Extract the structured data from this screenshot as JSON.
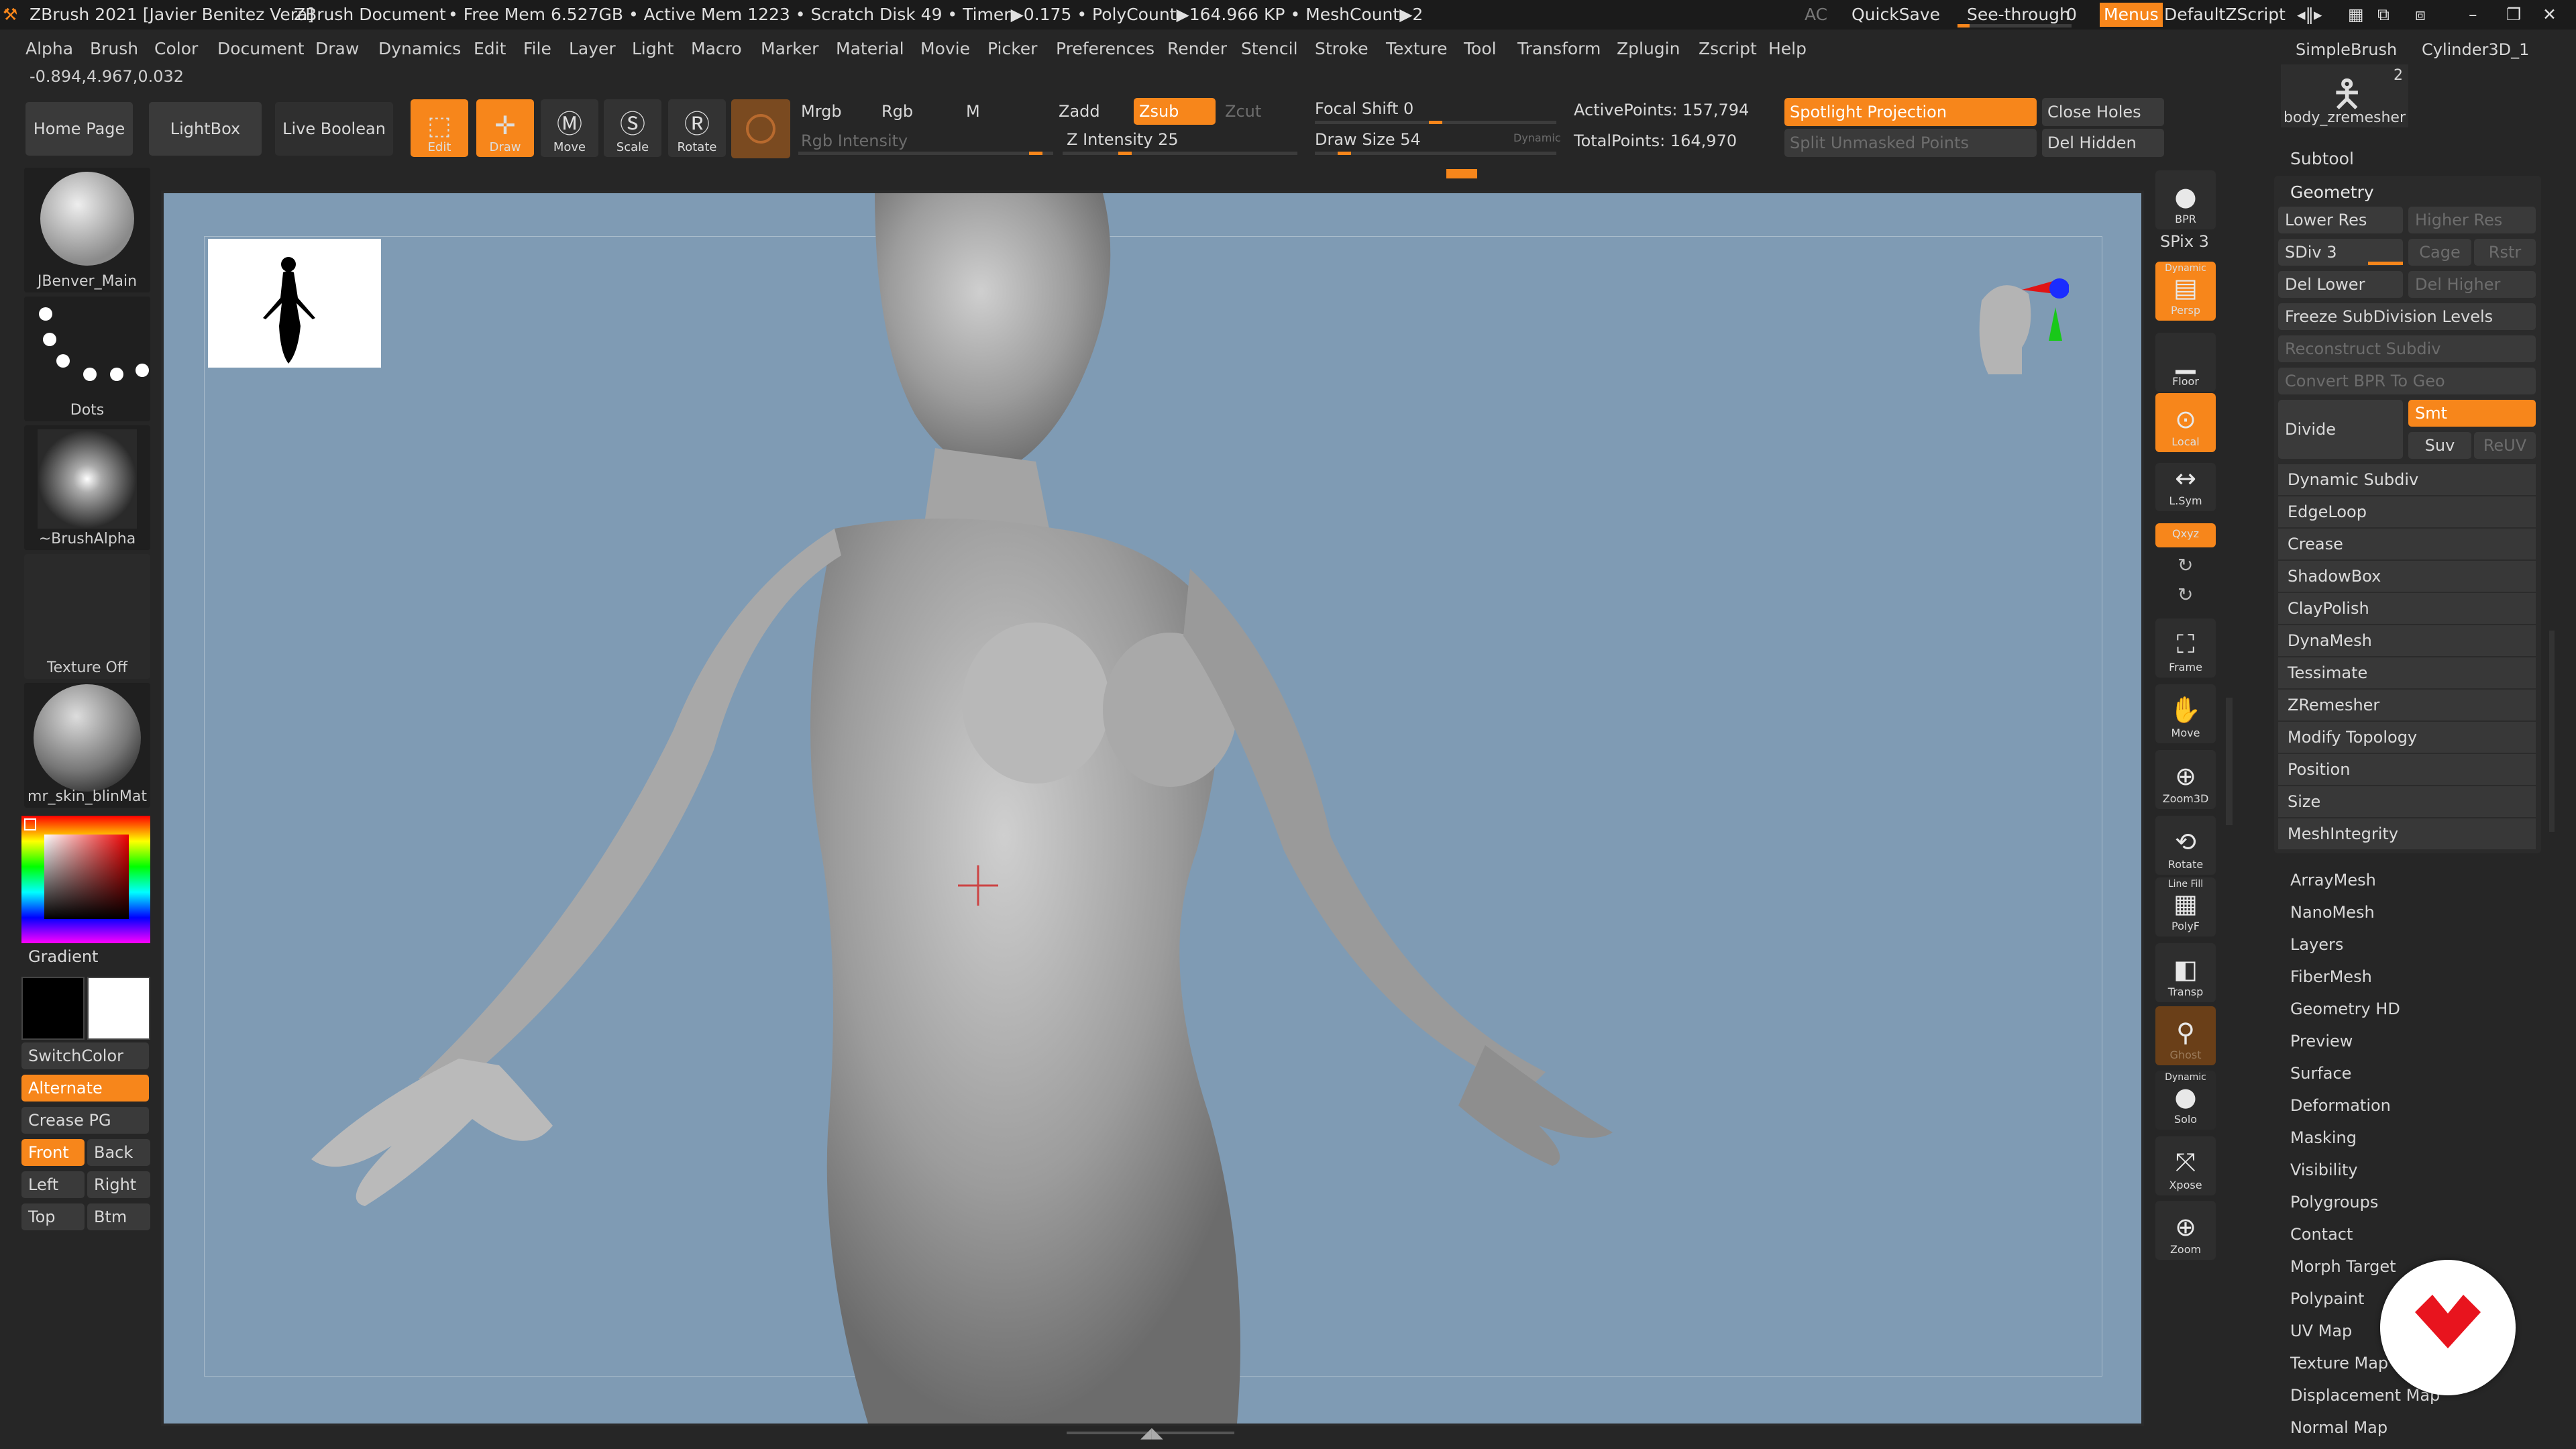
{
  "title_bar": {
    "app_title": "ZBrush 2021 [Javier Benitez Vera]",
    "document": "ZBrush Document",
    "stats": "• Free Mem 6.527GB • Active Mem 1223 • Scratch Disk 49 • Timer▶0.175 • PolyCount▶164.966 KP • MeshCount▶2",
    "ac": "AC",
    "quicksave": "QuickSave",
    "see_through": "See-through",
    "see_through_value": "0",
    "menus": "Menus",
    "script": "DefaultZScript"
  },
  "menu": [
    "Alpha",
    "Brush",
    "Color",
    "Document",
    "Draw",
    "Dynamics",
    "Edit",
    "File",
    "Layer",
    "Light",
    "Macro",
    "Marker",
    "Material",
    "Movie",
    "Picker",
    "Preferences",
    "Render",
    "Stencil",
    "Stroke",
    "Texture",
    "Tool",
    "Transform",
    "Zplugin",
    "Zscript",
    "Help"
  ],
  "coords": "-0.894,4.967,0.032",
  "shelf": {
    "home": "Home Page",
    "lightbox": "LightBox",
    "live_boolean": "Live Boolean"
  },
  "tools": {
    "edit": "Edit",
    "draw": "Draw",
    "move": "Move",
    "scale": "Scale",
    "rotate": "Rotate"
  },
  "color_modes": {
    "mrgb": "Mrgb",
    "rgb": "Rgb",
    "m": "M",
    "rgb_intensity": "Rgb Intensity"
  },
  "z_modes": {
    "zadd": "Zadd",
    "zsub": "Zsub",
    "zcut": "Zcut",
    "z_intensity": "Z Intensity 25",
    "z_intensity_value": 0.25
  },
  "focal": {
    "label": "Focal Shift 0",
    "value": 0.5
  },
  "draw_size": {
    "label": "Draw Size 54",
    "dynamic": "Dynamic",
    "value": 0.1
  },
  "points": {
    "active": "ActivePoints: 157,794",
    "total": "TotalPoints: 164,970"
  },
  "spotlight": {
    "projection": "Spotlight Projection",
    "split": "Split Unmasked Points",
    "close_holes": "Close Holes",
    "del_hidden": "Del Hidden"
  },
  "left": {
    "brush": "JBenver_Main",
    "stroke": "Dots",
    "alpha": "~BrushAlpha",
    "texture": "Texture Off",
    "material": "mr_skin_blinMat",
    "gradient": "Gradient",
    "switch": "SwitchColor",
    "alternate": "Alternate",
    "crease": "Crease PG",
    "front": "Front",
    "back": "Back",
    "left": "Left",
    "right": "Right",
    "top": "Top",
    "btm": "Btm"
  },
  "right_tools": {
    "bpr": "BPR",
    "spix": "SPix 3",
    "persp": "Persp",
    "dynamic": "Dynamic",
    "floor": "Floor",
    "local": "Local",
    "lsym": "L.Sym",
    "xyz": "Qxyz",
    "frame": "Frame",
    "move": "Move",
    "zoom3d": "Zoom3D",
    "rotate": "Rotate",
    "linefill": "Line Fill",
    "polyf": "PolyF",
    "transp": "Transp",
    "ghost": "Ghost",
    "solo": "Solo",
    "xpose": "Xpose",
    "zoom": "Zoom"
  },
  "tool_thumbs": {
    "simplebrush": "SimpleBrush",
    "cylinder": "Cylinder3D_1",
    "count": "2",
    "mesh": "body_zremesher"
  },
  "subtool": "Subtool",
  "geometry": {
    "title": "Geometry",
    "lower_res": "Lower Res",
    "higher_res": "Higher Res",
    "sdiv": "SDiv 3",
    "cage": "Cage",
    "rstr": "Rstr",
    "del_lower": "Del Lower",
    "del_higher": "Del Higher",
    "freeze": "Freeze SubDivision Levels",
    "reconstruct": "Reconstruct Subdiv",
    "convert": "Convert BPR To Geo",
    "divide": "Divide",
    "smt": "Smt",
    "suv": "Suv",
    "reuv": "ReUV",
    "items": [
      "Dynamic Subdiv",
      "EdgeLoop",
      "Crease",
      "ShadowBox",
      "ClayPolish",
      "DynaMesh",
      "Tessimate",
      "ZRemesher",
      "Modify Topology",
      "Position",
      "Size",
      "MeshIntegrity"
    ]
  },
  "subpalettes": [
    "ArrayMesh",
    "NanoMesh",
    "Layers",
    "FiberMesh",
    "Geometry HD",
    "Preview",
    "Surface",
    "Deformation",
    "Masking",
    "Visibility",
    "Polygroups",
    "Contact",
    "Morph Target",
    "Polypaint",
    "UV Map",
    "Texture Map",
    "Displacement Map",
    "Normal Map"
  ],
  "colors": {
    "accent": "#f7861b",
    "bg": "#262626",
    "viewport": "#7f9bb4",
    "brand": "#e8141e"
  }
}
